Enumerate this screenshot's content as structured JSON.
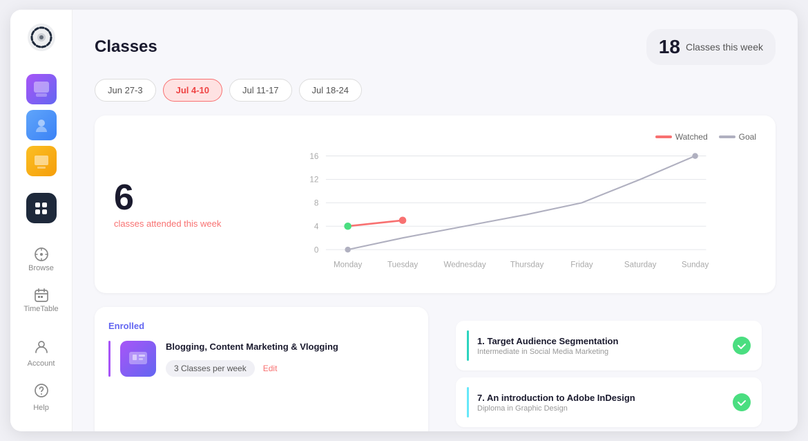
{
  "app": {
    "title": "Classes"
  },
  "sidebar": {
    "logo_alt": "Logo",
    "nav_items": [
      {
        "label": "Browse",
        "icon": "compass"
      },
      {
        "label": "TimeTable",
        "icon": "calendar"
      }
    ],
    "bottom_items": [
      {
        "label": "Account",
        "icon": "user"
      },
      {
        "label": "Help",
        "icon": "help-circle"
      }
    ]
  },
  "header": {
    "page_title": "Classes",
    "week_badge_number": "18",
    "week_badge_label": "Classes this week"
  },
  "week_tabs": [
    {
      "label": "Jun 27-3",
      "active": false
    },
    {
      "label": "Jul 4-10",
      "active": true
    },
    {
      "label": "Jul 11-17",
      "active": false
    },
    {
      "label": "Jul 18-24",
      "active": false
    }
  ],
  "chart": {
    "stat_number": "6",
    "stat_label": "classes attended this week",
    "legend": {
      "watched": "Watched",
      "goal": "Goal"
    },
    "y_labels": [
      "0",
      "4",
      "8",
      "12",
      "16"
    ],
    "x_labels": [
      "Monday",
      "Tuesday",
      "Wednesday",
      "Thursday",
      "Friday",
      "Saturday",
      "Sunday"
    ],
    "watched_data": [
      4,
      5,
      null,
      null,
      null,
      null,
      null
    ],
    "goal_data": [
      0,
      2,
      4,
      6,
      8,
      12,
      16
    ]
  },
  "enrolled": {
    "section_label": "Enrolled",
    "course": {
      "name": "Blogging, Content Marketing & Vlogging",
      "classes_per_week": "3 Classes per week",
      "edit_label": "Edit"
    }
  },
  "lessons": [
    {
      "number": "1.",
      "title": "Target Audience Segmentation",
      "subtitle": "Intermediate in Social Media Marketing",
      "accent_color": "teal",
      "completed": true
    },
    {
      "number": "7.",
      "title": "An introduction to Adobe InDesign",
      "subtitle": "Diploma in Graphic Design",
      "accent_color": "cyan",
      "completed": true
    }
  ]
}
